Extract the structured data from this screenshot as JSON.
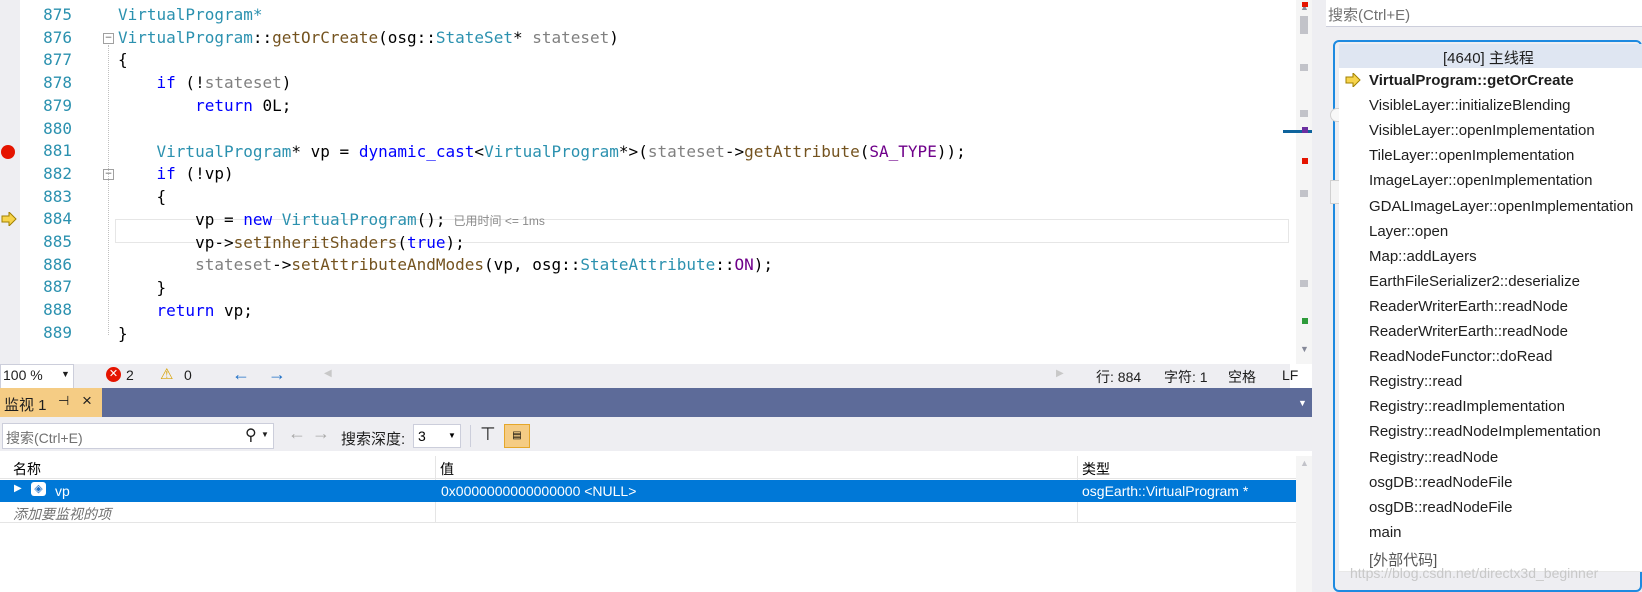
{
  "editor": {
    "line_numbers": [
      "875",
      "876",
      "877",
      "878",
      "879",
      "880",
      "881",
      "882",
      "883",
      "884",
      "885",
      "886",
      "887",
      "888",
      "889"
    ],
    "lines": [
      "VirtualProgram*",
      "VirtualProgram::getOrCreate(osg::StateSet* stateset)",
      "{",
      "    if (!stateset)",
      "        return 0L;",
      "",
      "    VirtualProgram* vp = dynamic_cast<VirtualProgram*>(stateset->getAttribute(SA_TYPE));",
      "    if (!vp)",
      "    {",
      "        vp = new VirtualProgram();",
      "        vp->setInheritShaders(true);",
      "        stateset->setAttributeAndModes(vp, osg::StateAttribute::ON);",
      "    }",
      "    return vp;",
      "}"
    ],
    "elapsed_hint": "已用时间 <= 1ms",
    "breakpoint_line": "881",
    "current_line": "884"
  },
  "status": {
    "zoom": "100 %",
    "errors": "2",
    "warnings": "0",
    "line": "行: 884",
    "char": "字符: 1",
    "whitespace": "空格",
    "eol": "LF"
  },
  "watch": {
    "tab_label": "监视 1",
    "search_placeholder": "搜索(Ctrl+E)",
    "depth_label": "搜索深度:",
    "depth_value": "3",
    "columns": [
      "名称",
      "值",
      "类型"
    ],
    "rows": [
      {
        "name": "vp",
        "value": "0x0000000000000000 <NULL>",
        "type": "osgEarth::VirtualProgram *"
      }
    ],
    "add_item_placeholder": "添加要监视的项"
  },
  "callstack": {
    "search_placeholder": "搜索(Ctrl+E)",
    "thread_title": "[4640] 主线程",
    "frames": [
      "VirtualProgram::getOrCreate",
      "VisibleLayer::initializeBlending",
      "VisibleLayer::openImplementation",
      "TileLayer::openImplementation",
      "ImageLayer::openImplementation",
      "GDALImageLayer::openImplementation",
      "Layer::open",
      "Map::addLayers",
      "EarthFileSerializer2::deserialize",
      "ReaderWriterEarth::readNode",
      "ReaderWriterEarth::readNode",
      "ReadNodeFunctor::doRead",
      "Registry::read",
      "Registry::readImplementation",
      "Registry::readNodeImplementation",
      "Registry::readNode",
      "osgDB::readNodeFile",
      "osgDB::readNodeFile",
      "main",
      "[外部代码]"
    ],
    "watermark": "https://blog.csdn.net/directx3d_beginner"
  },
  "colors": {
    "selection": "#0078d7",
    "type_color": "#2b91af",
    "keyword": "#0000ff",
    "function": "#74531f",
    "watch_tab": "#f5cc84",
    "title_bar": "#5d6b99"
  }
}
